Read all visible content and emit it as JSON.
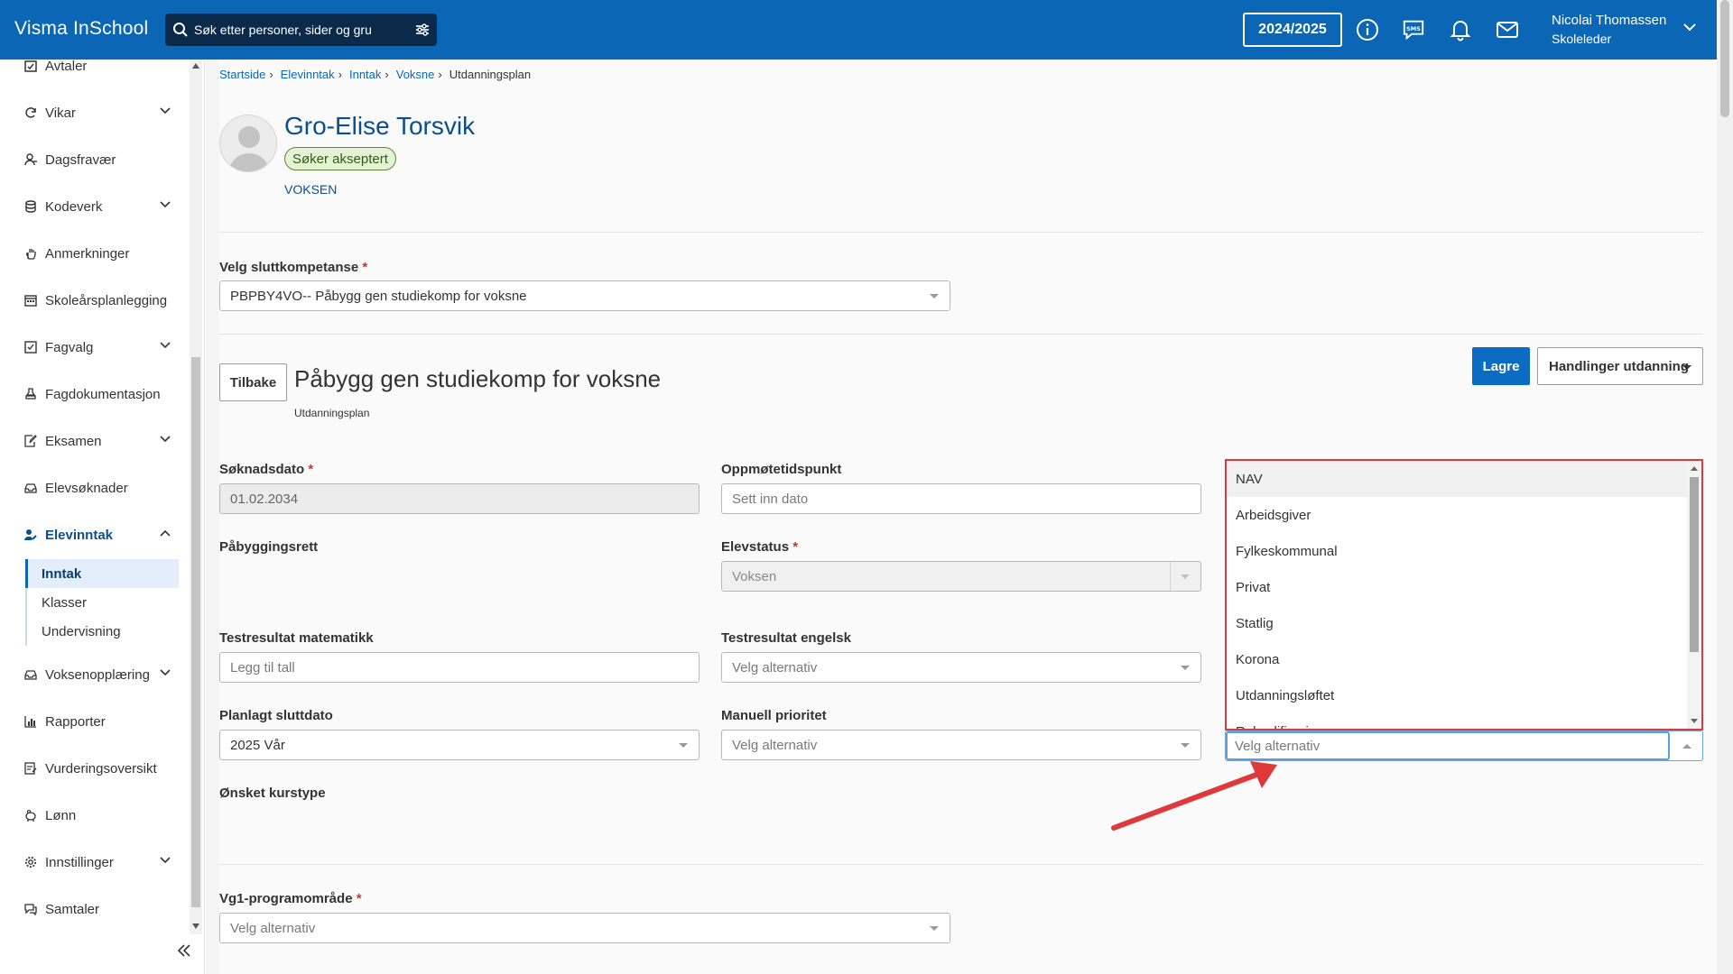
{
  "app": {
    "brand": "Visma InSchool",
    "search_placeholder": "Søk etter personer, sider og gru",
    "school_year": "2024/2025",
    "user_name": "Nicolai Thomassen",
    "user_role": "Skoleleder"
  },
  "sidebar": {
    "items": [
      {
        "label": "Avtaler",
        "icon": "calendar-check-icon"
      },
      {
        "label": "Vikar",
        "icon": "refresh-icon"
      },
      {
        "label": "Dagsfravær",
        "icon": "user-minus-icon"
      },
      {
        "label": "Kodeverk",
        "icon": "database-icon"
      },
      {
        "label": "Anmerkninger",
        "icon": "hand-icon"
      },
      {
        "label": "Skoleårsplanlegging",
        "icon": "calendar-icon"
      },
      {
        "label": "Fagvalg",
        "icon": "checkbox-icon"
      },
      {
        "label": "Fagdokumentasjon",
        "icon": "stamp-icon"
      },
      {
        "label": "Eksamen",
        "icon": "edit-doc-icon"
      },
      {
        "label": "Elevsøknader",
        "icon": "inbox-icon"
      },
      {
        "label": "Elevinntak",
        "icon": "user-edit-icon"
      },
      {
        "label": "Voksenopplæring",
        "icon": "inbox-icon"
      },
      {
        "label": "Rapporter",
        "icon": "chart-icon"
      },
      {
        "label": "Vurderingsoversikt",
        "icon": "assessment-icon"
      },
      {
        "label": "Lønn",
        "icon": "piggy-icon"
      },
      {
        "label": "Innstillinger",
        "icon": "gear-icon"
      },
      {
        "label": "Samtaler",
        "icon": "chat-icon"
      }
    ],
    "subitems": [
      "Inntak",
      "Klasser",
      "Undervisning"
    ]
  },
  "breadcrumb": [
    "Startside",
    "Elevinntak",
    "Inntak",
    "Voksne",
    "Utdanningsplan"
  ],
  "person": {
    "name": "Gro-Elise Torsvik",
    "status": "Søker akseptert",
    "tag": "VOKSEN"
  },
  "form": {
    "sluttkompetanse_label": "Velg sluttkompetanse",
    "sluttkompetanse_value": "PBPBY4VO-- Påbygg gen studiekomp for voksne",
    "back_label": "Tilbake",
    "section_title": "Påbygg gen studiekomp for voksne",
    "section_sub": "Utdanningsplan",
    "save_label": "Lagre",
    "actions_label": "Handlinger utdanning",
    "soknadsdato_label": "Søknadsdato",
    "soknadsdato_value": "01.02.2034",
    "oppmote_label": "Oppmøtetidspunkt",
    "oppmote_placeholder": "Sett inn dato",
    "pabygg_label": "Påbyggingsrett",
    "elevstatus_label": "Elevstatus",
    "elevstatus_value": "Voksen",
    "matte_label": "Testresultat matematikk",
    "matte_placeholder": "Legg til tall",
    "engelsk_label": "Testresultat engelsk",
    "engelsk_value": "Velg alternativ",
    "sluttdato_label": "Planlagt sluttdato",
    "sluttdato_value": "2025 Vår",
    "prioritet_label": "Manuell prioritet",
    "prioritet_value": "Velg alternativ",
    "kurstype_label": "Ønsket kurstype",
    "vg1_label": "Vg1-programområde",
    "vg1_value": "Velg alternativ",
    "required_mark": "*"
  },
  "dropdown": {
    "options": [
      "NAV",
      "Arbeidsgiver",
      "Fylkeskommunal",
      "Privat",
      "Statlig",
      "Korona",
      "Utdanningsløftet",
      "Rekvalifisering"
    ],
    "input_placeholder": "Velg alternativ",
    "highlight_color": "#e0393c"
  },
  "colors": {
    "brand_blue": "#0b67b6",
    "annotation_red": "#e0393c"
  }
}
